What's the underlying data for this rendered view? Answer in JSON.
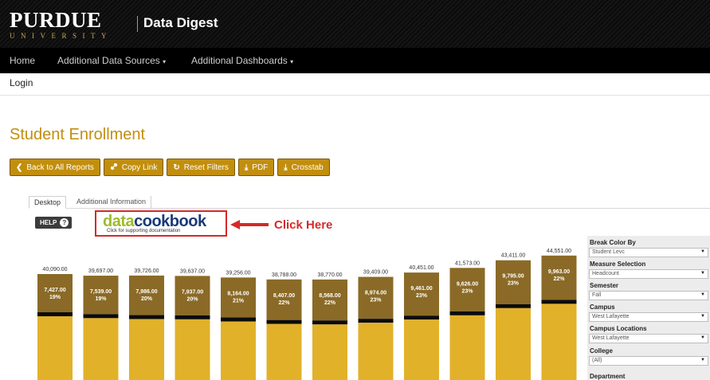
{
  "brand": {
    "name": "PURDUE",
    "subname": "UNIVERSITY",
    "site_title": "Data Digest"
  },
  "nav": {
    "items": [
      {
        "label": "Home"
      },
      {
        "label": "Additional Data Sources"
      },
      {
        "label": "Additional Dashboards"
      }
    ]
  },
  "login": "Login",
  "page_title": "Student Enrollment",
  "buttons": [
    {
      "label": "Back to All Reports",
      "icon": "chevron-left-icon",
      "glyph": "❮"
    },
    {
      "label": "Copy Link",
      "icon": "link-icon",
      "glyph": "🔗"
    },
    {
      "label": "Reset Filters",
      "icon": "refresh-icon",
      "glyph": "↻"
    },
    {
      "label": "PDF",
      "icon": "download-icon",
      "glyph": "⤓"
    },
    {
      "label": "Crosstab",
      "icon": "download-icon",
      "glyph": "⤓"
    }
  ],
  "tabs": [
    {
      "label": "Desktop"
    },
    {
      "label": "Additional Information"
    }
  ],
  "help": {
    "label": "HELP",
    "glyph": "?"
  },
  "cookbook": {
    "part1": "data",
    "part2": "cookbook",
    "subtitle": "Click for supporting documentation"
  },
  "callout": "Click Here",
  "colors": {
    "gold": "#c28e0e",
    "dark_gold": "#8a6a26",
    "light_gold": "#e2b12a",
    "black": "#0b0b0b",
    "red": "#d42a2a"
  },
  "chart_data": {
    "type": "bar",
    "stacked": true,
    "ylim": [
      0,
      46000
    ],
    "totals": [
      40090,
      39697,
      39726,
      39637,
      39256,
      38788,
      38770,
      39409,
      40451,
      41573,
      43411,
      44551
    ],
    "total_labels": [
      "40,090.00",
      "39,697.00",
      "39,726.00",
      "39,637.00",
      "39,256.00",
      "38,788.00",
      "38,770.00",
      "39,409.00",
      "40,451.00",
      "41,573.00",
      "43,411.00",
      "44,551.00"
    ],
    "series": [
      {
        "values": [
          7427,
          7539,
          7986,
          7937,
          8164,
          8407,
          8568,
          8974,
          9461,
          9626,
          9795,
          9963
        ],
        "labels": [
          "7,427.00",
          "7,539.00",
          "7,986.00",
          "7,937.00",
          "8,164.00",
          "8,407.00",
          "8,568.00",
          "8,974.00",
          "9,461.00",
          "9,626.00",
          "9,795.00",
          "9,963.00"
        ],
        "pct_labels": [
          "19%",
          "19%",
          "20%",
          "20%",
          "21%",
          "22%",
          "22%",
          "23%",
          "23%",
          "23%",
          "23%",
          "22%"
        ]
      }
    ]
  },
  "filters": [
    {
      "label": "Break Color By",
      "value": "Student Levc"
    },
    {
      "label": "Measure Selection",
      "value": "Headcount"
    },
    {
      "label": "Semester",
      "value": "Fall"
    },
    {
      "label": "Campus",
      "value": "West Lafayette"
    },
    {
      "label": "Campus Locations",
      "value": "West Lafayette"
    },
    {
      "label": "College",
      "value": "(All)"
    },
    {
      "label": "Department",
      "value": ""
    }
  ]
}
